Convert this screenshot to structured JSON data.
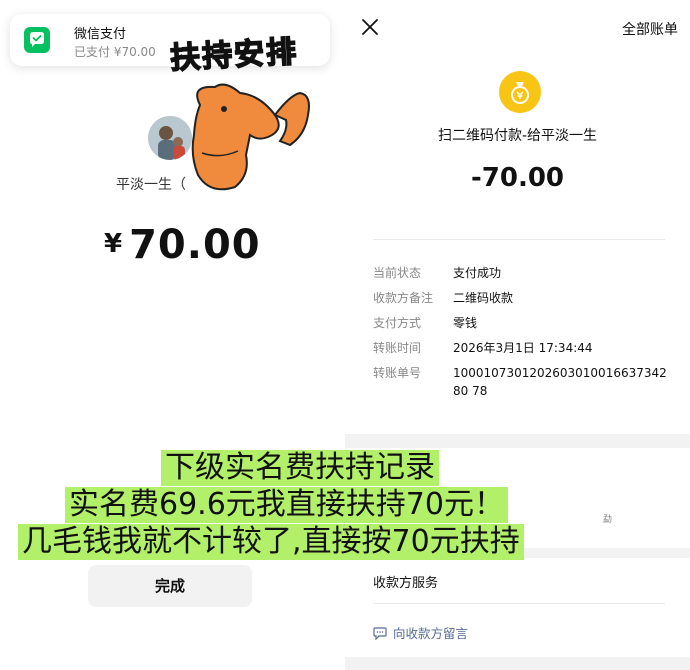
{
  "notification": {
    "app_name": "微信支付",
    "message": "已支付 ¥70.00"
  },
  "sticker": {
    "text": "扶持安排"
  },
  "left": {
    "payee_name": "平淡一生（",
    "currency_symbol": "¥",
    "amount": "70.00",
    "done_label": "完成"
  },
  "right": {
    "all_bills_label": "全部账单",
    "title": "扫二维码付款-给平淡一生",
    "amount": "-70.00",
    "details": [
      {
        "label": "当前状态",
        "value": "支付成功"
      },
      {
        "label": "收款方备注",
        "value": "二维码收款"
      },
      {
        "label": "支付方式",
        "value": "零钱"
      },
      {
        "label": "转账时间",
        "value": "2026年3月1日 17:34:44"
      },
      {
        "label": "转账单号",
        "value": "100010730120260301001663734280 78"
      }
    ],
    "small_text": "勐",
    "service_label": "收款方服务",
    "message_label": "向收款方留言"
  },
  "caption": {
    "line1": "下级实名费扶持记录",
    "line2": "实名费69.6元我直接扶持70元！",
    "line3": "几毛钱我就不计较了,直接按70元扶持"
  },
  "colors": {
    "wechat_green": "#07c160",
    "coin_yellow": "#f8c515",
    "caption_bg": "#b3f06a",
    "link_blue": "#576b95"
  }
}
